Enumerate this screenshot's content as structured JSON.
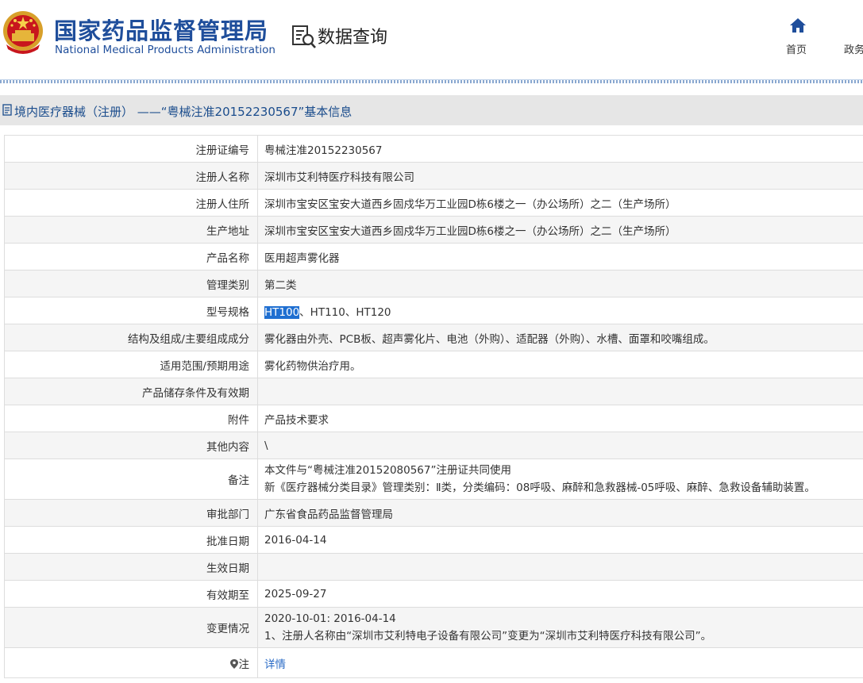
{
  "header": {
    "title_cn": "国家药品监督管理局",
    "title_en": "National Medical Products Administration",
    "section": "数据查询",
    "nav": [
      {
        "label": "首页",
        "icon": "home-icon"
      },
      {
        "label": "政务"
      }
    ]
  },
  "page": {
    "heading": "境内医疗器械（注册） ——“粤械注准20152230567”基本信息"
  },
  "rows": [
    {
      "label": "注册证编号",
      "value": "粤械注准20152230567"
    },
    {
      "label": "注册人名称",
      "value": "深圳市艾利特医疗科技有限公司"
    },
    {
      "label": "注册人住所",
      "value": "深圳市宝安区宝安大道西乡固戍华万工业园D栋6楼之一（办公场所）之二（生产场所）"
    },
    {
      "label": "生产地址",
      "value": "深圳市宝安区宝安大道西乡固戍华万工业园D栋6楼之一（办公场所）之二（生产场所）"
    },
    {
      "label": "产品名称",
      "value": "医用超声雾化器"
    },
    {
      "label": "管理类别",
      "value": "第二类"
    },
    {
      "label": "型号规格",
      "value_highlight": "HT100",
      "value_rest": "、HT110、HT120"
    },
    {
      "label": "结构及组成/主要组成成分",
      "value": "雾化器由外壳、PCB板、超声雾化片、电池（外购）、适配器（外购）、水槽、面罩和咬嘴组成。"
    },
    {
      "label": "适用范围/预期用途",
      "value": "雾化药物供治疗用。"
    },
    {
      "label": "产品储存条件及有效期",
      "value": ""
    },
    {
      "label": "附件",
      "value": "产品技术要求"
    },
    {
      "label": "其他内容",
      "value": "\\"
    },
    {
      "label": "备注",
      "line1": "本文件与“粤械注准20152080567”注册证共同使用",
      "line2": "新《医疗器械分类目录》管理类别：Ⅱ类，分类编码：08呼吸、麻醉和急救器械-05呼吸、麻醉、急救设备辅助装置。"
    },
    {
      "label": "审批部门",
      "value": "广东省食品药品监督管理局"
    },
    {
      "label": "批准日期",
      "value": "2016-04-14"
    },
    {
      "label": "生效日期",
      "value": ""
    },
    {
      "label": "有效期至",
      "value": "2025-09-27"
    },
    {
      "label": "变更情况",
      "line1": "2020-10-01: 2016-04-14",
      "line2": "1、注册人名称由“深圳市艾利特电子设备有限公司”变更为“深圳市艾利特医疗科技有限公司”。"
    },
    {
      "label": "注",
      "value": "详情",
      "icon": "pin-icon"
    }
  ]
}
